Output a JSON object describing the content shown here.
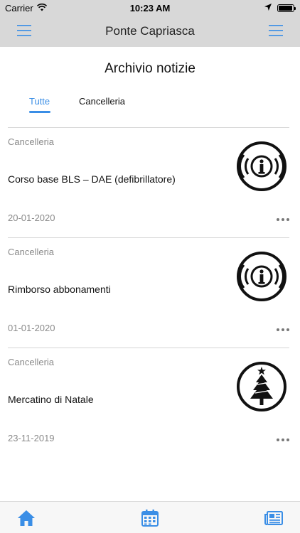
{
  "status_bar": {
    "carrier": "Carrier",
    "time": "10:23 AM",
    "battery_level": 0.95
  },
  "nav": {
    "title": "Ponte Capriasca"
  },
  "page": {
    "title": "Archivio notizie"
  },
  "tabs": [
    {
      "label": "Tutte",
      "active": true
    },
    {
      "label": "Cancelleria",
      "active": false
    }
  ],
  "news": [
    {
      "category": "Cancelleria",
      "title": "Corso base BLS – DAE (defibrillatore)",
      "date": "20-01-2020",
      "icon": "info-icon"
    },
    {
      "category": "Cancelleria",
      "title": "Rimborso abbonamenti",
      "date": "01-01-2020",
      "icon": "info-icon"
    },
    {
      "category": "Cancelleria",
      "title": "Mercatino di Natale",
      "date": "23-11-2019",
      "icon": "christmas-tree-icon"
    }
  ],
  "tab_bar": [
    {
      "icon": "home-icon",
      "active": true
    },
    {
      "icon": "calendar-icon",
      "active": false
    },
    {
      "icon": "newspaper-icon",
      "active": false
    }
  ],
  "colors": {
    "accent": "#3a8ee6",
    "bar_bg": "#d8d8d8",
    "muted_text": "#8a8a8a"
  }
}
